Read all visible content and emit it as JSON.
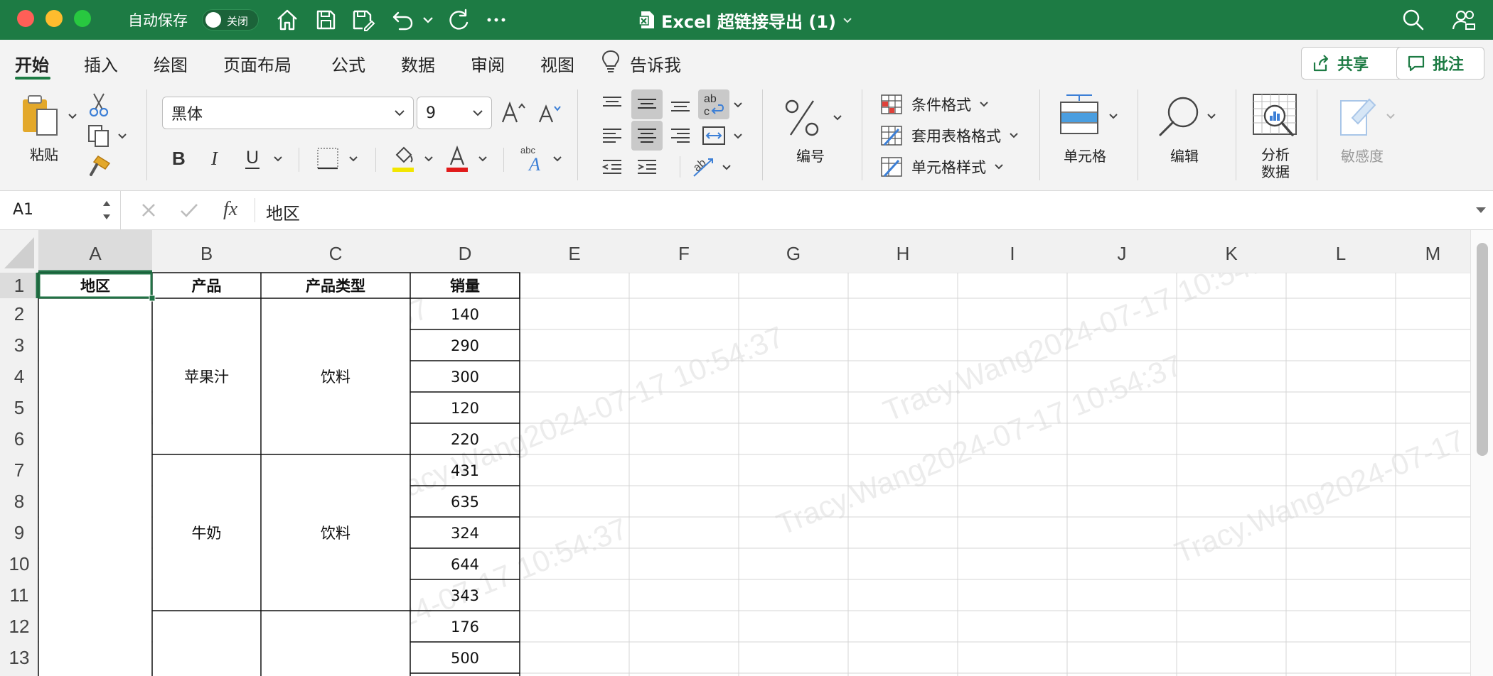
{
  "window": {
    "title": "Excel 超链接导出 (1)",
    "autosave_label": "自动保存",
    "autosave_state": "关闭"
  },
  "ribbon_tabs": [
    "开始",
    "插入",
    "绘图",
    "页面布局",
    "公式",
    "数据",
    "审阅",
    "视图",
    "告诉我"
  ],
  "ribbon_buttons": {
    "share": "共享",
    "comments": "批注"
  },
  "ribbon": {
    "paste": "粘贴",
    "font_name": "黑体",
    "font_size": "9",
    "number": "编号",
    "conditional_format": "条件格式",
    "table_format": "套用表格格式",
    "cell_styles": "单元格样式",
    "cells": "单元格",
    "editing": "编辑",
    "analyze_line1": "分析",
    "analyze_line2": "数据",
    "sensitivity": "敏感度"
  },
  "formula_bar": {
    "name_box": "A1",
    "fx": "fx",
    "content": "地区"
  },
  "grid": {
    "columns": [
      "A",
      "B",
      "C",
      "D",
      "E",
      "F",
      "G",
      "H",
      "I",
      "J",
      "K",
      "L",
      "M"
    ],
    "rows": [
      "1",
      "2",
      "3",
      "4",
      "5",
      "6",
      "7",
      "8",
      "9",
      "10",
      "11",
      "12",
      "13"
    ],
    "headers": [
      "地区",
      "产品",
      "产品类型",
      "销量"
    ],
    "groups": [
      {
        "product": "苹果汁",
        "type": "饮料"
      },
      {
        "product": "牛奶",
        "type": "饮料"
      }
    ],
    "sales": [
      "140",
      "290",
      "300",
      "120",
      "220",
      "431",
      "635",
      "324",
      "644",
      "343",
      "176",
      "500"
    ],
    "watermark": "Tracy.Wang2024-07-17 10:54:37"
  },
  "colors": {
    "brand": "#1d7b44",
    "selection": "#217346"
  }
}
